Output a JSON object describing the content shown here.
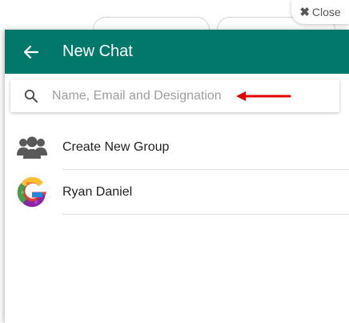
{
  "close_button": {
    "label": "Close",
    "icon": "close-x-icon"
  },
  "header": {
    "title": "New Chat",
    "back_icon": "arrow-left-icon",
    "background_color": "#00796b"
  },
  "search": {
    "placeholder": "Name, Email and Designation",
    "value": "",
    "icon": "search-icon",
    "annotation": "red-arrow-pointing-left"
  },
  "list": {
    "items": [
      {
        "label": "Create New Group",
        "icon": "group-icon"
      },
      {
        "label": "Ryan Daniel",
        "icon": "colorful-letter-g-avatar"
      }
    ]
  },
  "colors": {
    "accent": "#00796b",
    "arrow": "#e00000",
    "text_primary": "#212121",
    "text_placeholder": "#9e9e9e"
  }
}
